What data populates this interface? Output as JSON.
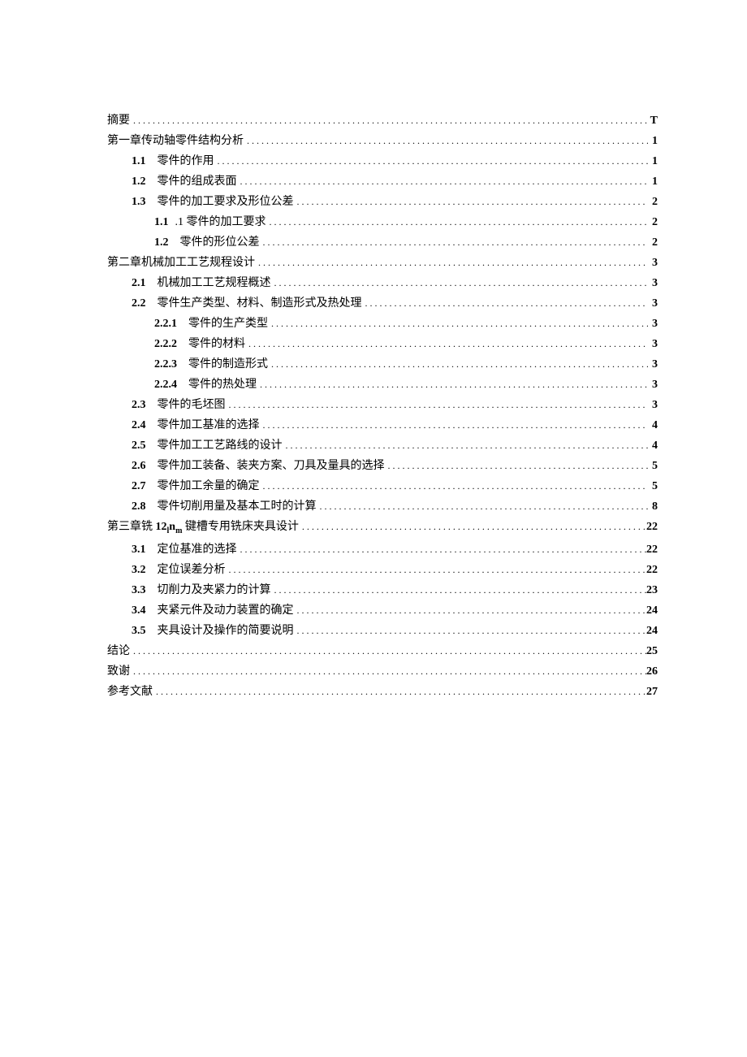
{
  "toc": {
    "entries": [
      {
        "indent": 0,
        "num": "",
        "title": "摘要",
        "page": "T"
      },
      {
        "indent": 0,
        "num": "",
        "title": "第一章传动轴零件结构分析",
        "page": "1"
      },
      {
        "indent": 1,
        "num": "1.1",
        "title": "零件的作用",
        "page": "1"
      },
      {
        "indent": 1,
        "num": "1.2",
        "title": "零件的组成表面",
        "page": "1"
      },
      {
        "indent": 1,
        "num": "1.3",
        "title": "零件的加工要求及形位公差",
        "page": "2"
      },
      {
        "indent": 2,
        "num": "1.1",
        "title": ".1 零件的加工要求",
        "page": "2"
      },
      {
        "indent": 2,
        "num": "1.2",
        "title": "零件的形位公差",
        "page": "2"
      },
      {
        "indent": 0,
        "num": "",
        "title": "第二章机械加工工艺规程设计",
        "page": "3"
      },
      {
        "indent": 1,
        "num": "2.1",
        "title": "机械加工工艺规程概述",
        "page": "3"
      },
      {
        "indent": 1,
        "num": "2.2",
        "title": "零件生产类型、材料、制造形式及热处理",
        "page": "3"
      },
      {
        "indent": 2,
        "num": "2.2.1",
        "title": "零件的生产类型",
        "page": "3"
      },
      {
        "indent": 2,
        "num": "2.2.2",
        "title": "零件的材料",
        "page": "3"
      },
      {
        "indent": 2,
        "num": "2.2.3",
        "title": "零件的制造形式",
        "page": "3"
      },
      {
        "indent": 2,
        "num": "2.2.4",
        "title": "零件的热处理",
        "page": "3"
      },
      {
        "indent": 1,
        "num": "2.3",
        "title": "零件的毛坯图",
        "page": "3"
      },
      {
        "indent": 1,
        "num": "2.4",
        "title": "零件加工基准的选择",
        "page": "4"
      },
      {
        "indent": 1,
        "num": "2.5",
        "title": "零件加工工艺路线的设计",
        "page": "4"
      },
      {
        "indent": 1,
        "num": "2.6",
        "title": "零件加工装备、装夹方案、刀具及量具的选择",
        "page": "5"
      },
      {
        "indent": 1,
        "num": "2.7",
        "title": "零件加工余量的确定",
        "page": "5"
      },
      {
        "indent": 1,
        "num": "2.8",
        "title": "零件切削用量及基本工时的计算",
        "page": "8"
      },
      {
        "indent": 0,
        "num": "",
        "title_html": "第三章铣 <b>12<span class='sub'>l</span>n<span class='sub'>m</span></b> 键槽专用铣床夹具设计",
        "title": "第三章铣 12lnm 键槽专用铣床夹具设计",
        "page": "22"
      },
      {
        "indent": 1,
        "num": "3.1",
        "title": "定位基准的选择",
        "page": "22"
      },
      {
        "indent": 1,
        "num": "3.2",
        "title": "定位误差分析",
        "page": "22"
      },
      {
        "indent": 1,
        "num": "3.3",
        "title": "切削力及夹紧力的计算",
        "page": "23"
      },
      {
        "indent": 1,
        "num": "3.4",
        "title": "夹紧元件及动力装置的确定",
        "page": "24"
      },
      {
        "indent": 1,
        "num": "3.5",
        "title": "夹具设计及操作的简要说明",
        "page": "24"
      },
      {
        "indent": 0,
        "num": "",
        "title": "结论",
        "page": "25"
      },
      {
        "indent": 0,
        "num": "",
        "title": "致谢",
        "page": "26"
      },
      {
        "indent": 0,
        "num": "",
        "title": "参考文献",
        "page": "27"
      }
    ]
  }
}
